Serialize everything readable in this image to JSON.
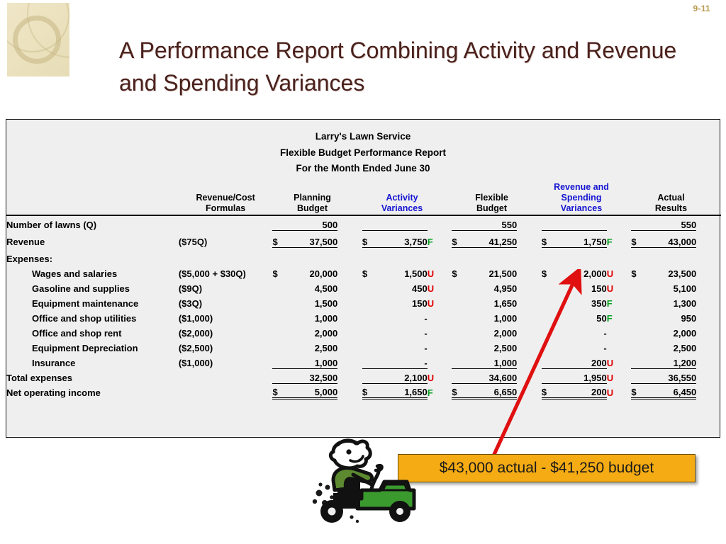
{
  "page_number": "9-11",
  "slide": {
    "title": "A Performance Report Combining Activity and Revenue and Spending Variances"
  },
  "report": {
    "company": "Larry's Lawn Service",
    "report_name": "Flexible Budget Performance Report",
    "period": "For the Month Ended June 30",
    "columns": [
      {
        "line1": "Revenue/Cost",
        "line2": "Formulas",
        "accent": "#000000"
      },
      {
        "line1": "Planning",
        "line2": "Budget",
        "accent": "#000000"
      },
      {
        "line1": "Activity",
        "line2": "Variances",
        "accent": "#1414d2"
      },
      {
        "line1": "Flexible",
        "line2": "Budget",
        "accent": "#000000"
      },
      {
        "line1": "Revenue and",
        "line1b": "Spending",
        "line2": "Variances",
        "accent": "#1414d2"
      },
      {
        "line1": "Actual",
        "line2": "Results",
        "accent": "#000000"
      }
    ],
    "rows": [
      {
        "label": "Number of lawns (Q)",
        "indent": false,
        "formula": "",
        "planning": "500",
        "planning_cur": "",
        "act_var": "",
        "act_var_cur": "",
        "act_var_fu": "",
        "flexible": "550",
        "flexible_cur": "",
        "rs_var": "",
        "rs_var_cur": "",
        "rs_var_fu": "",
        "actual": "550",
        "actual_cur": ""
      },
      {
        "label": "Revenue",
        "indent": false,
        "formula": "($75Q)",
        "planning": "37,500",
        "planning_cur": "$",
        "act_var": "3,750",
        "act_var_cur": "$",
        "act_var_fu": "F",
        "flexible": "41,250",
        "flexible_cur": "$",
        "rs_var": "1,750",
        "rs_var_cur": "$",
        "rs_var_fu": "F",
        "actual": "43,000",
        "actual_cur": "$"
      },
      {
        "label": "Expenses:",
        "indent": false,
        "formula": "",
        "planning": "",
        "planning_cur": "",
        "act_var": "",
        "act_var_cur": "",
        "act_var_fu": "",
        "flexible": "",
        "flexible_cur": "",
        "rs_var": "",
        "rs_var_cur": "",
        "rs_var_fu": "",
        "actual": "",
        "actual_cur": ""
      },
      {
        "label": "Wages and salaries",
        "indent": true,
        "formula": "($5,000 + $30Q)",
        "planning": "20,000",
        "planning_cur": "$",
        "act_var": "1,500",
        "act_var_cur": "$",
        "act_var_fu": "U",
        "flexible": "21,500",
        "flexible_cur": "$",
        "rs_var": "2,000",
        "rs_var_cur": "$",
        "rs_var_fu": "U",
        "actual": "23,500",
        "actual_cur": "$"
      },
      {
        "label": "Gasoline and supplies",
        "indent": true,
        "formula": "($9Q)",
        "planning": "4,500",
        "planning_cur": "",
        "act_var": "450",
        "act_var_cur": "",
        "act_var_fu": "U",
        "flexible": "4,950",
        "flexible_cur": "",
        "rs_var": "150",
        "rs_var_cur": "",
        "rs_var_fu": "U",
        "actual": "5,100",
        "actual_cur": ""
      },
      {
        "label": "Equipment maintenance",
        "indent": true,
        "formula": "($3Q)",
        "planning": "1,500",
        "planning_cur": "",
        "act_var": "150",
        "act_var_cur": "",
        "act_var_fu": "U",
        "flexible": "1,650",
        "flexible_cur": "",
        "rs_var": "350",
        "rs_var_cur": "",
        "rs_var_fu": "F",
        "actual": "1,300",
        "actual_cur": ""
      },
      {
        "label": "Office and shop utilities",
        "indent": true,
        "formula": "($1,000)",
        "planning": "1,000",
        "planning_cur": "",
        "act_var": "-",
        "act_var_cur": "",
        "act_var_fu": "",
        "flexible": "1,000",
        "flexible_cur": "",
        "rs_var": "50",
        "rs_var_cur": "",
        "rs_var_fu": "F",
        "actual": "950",
        "actual_cur": ""
      },
      {
        "label": "Office and shop rent",
        "indent": true,
        "formula": "($2,000)",
        "planning": "2,000",
        "planning_cur": "",
        "act_var": "-",
        "act_var_cur": "",
        "act_var_fu": "",
        "flexible": "2,000",
        "flexible_cur": "",
        "rs_var": "-",
        "rs_var_cur": "",
        "rs_var_fu": "",
        "actual": "2,000",
        "actual_cur": ""
      },
      {
        "label": "Equipment Depreciation",
        "indent": true,
        "formula": "($2,500)",
        "planning": "2,500",
        "planning_cur": "",
        "act_var": "-",
        "act_var_cur": "",
        "act_var_fu": "",
        "flexible": "2,500",
        "flexible_cur": "",
        "rs_var": "-",
        "rs_var_cur": "",
        "rs_var_fu": "",
        "actual": "2,500",
        "actual_cur": ""
      },
      {
        "label": "Insurance",
        "indent": true,
        "formula": "($1,000)",
        "planning": "1,000",
        "planning_cur": "",
        "act_var": "-",
        "act_var_cur": "",
        "act_var_fu": "",
        "flexible": "1,000",
        "flexible_cur": "",
        "rs_var": "200",
        "rs_var_cur": "",
        "rs_var_fu": "U",
        "actual": "1,200",
        "actual_cur": ""
      },
      {
        "label": "Total expenses",
        "indent": false,
        "formula": "",
        "planning": "32,500",
        "planning_cur": "",
        "act_var": "2,100",
        "act_var_cur": "",
        "act_var_fu": "U",
        "flexible": "34,600",
        "flexible_cur": "",
        "rs_var": "1,950",
        "rs_var_cur": "",
        "rs_var_fu": "U",
        "actual": "36,550",
        "actual_cur": ""
      },
      {
        "label": "Net operating income",
        "indent": false,
        "formula": "",
        "planning": "5,000",
        "planning_cur": "$",
        "act_var": "1,650",
        "act_var_cur": "$",
        "act_var_fu": "F",
        "flexible": "6,650",
        "flexible_cur": "$",
        "rs_var": "200",
        "rs_var_cur": "$",
        "rs_var_fu": "U",
        "actual": "6,450",
        "actual_cur": "$"
      }
    ]
  },
  "callout": {
    "text": "$43,000 actual -  $41,250 budget",
    "fill_color": "#f5ab14",
    "arrow_color": "#e01010"
  },
  "colors": {
    "favorable": "#07a021",
    "unfavorable": "#e00000",
    "header_accent": "#1414d2",
    "title": "#4a211c"
  }
}
